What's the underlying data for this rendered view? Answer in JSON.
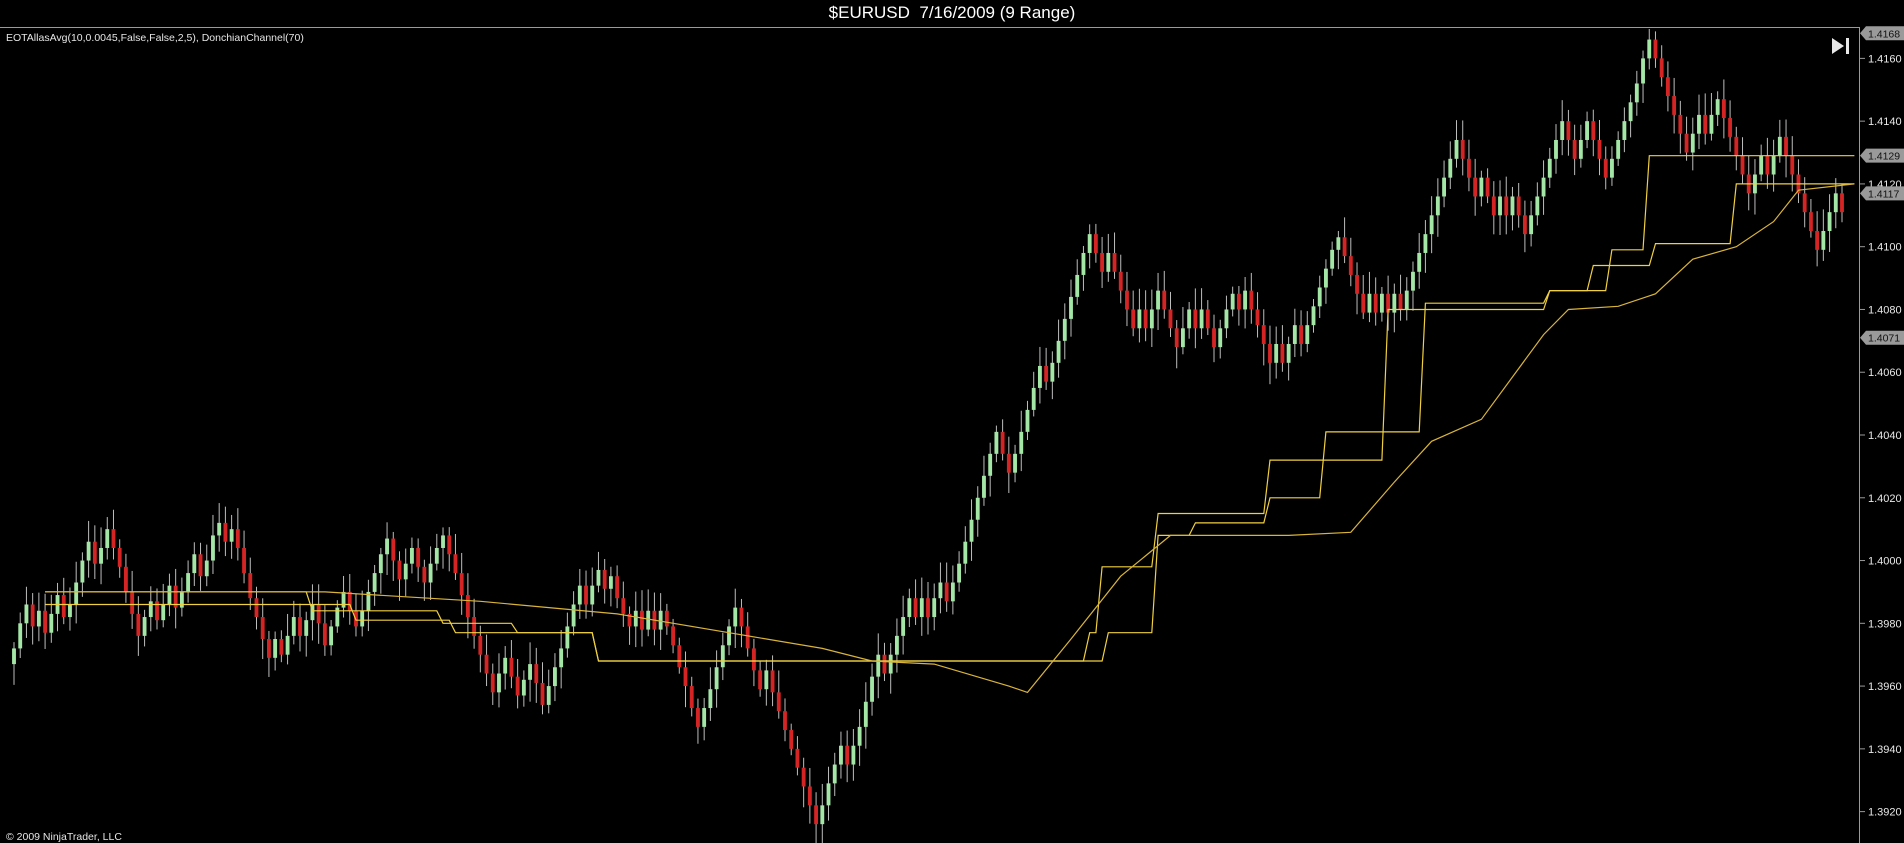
{
  "header": {
    "title": "$EURUSD  7/16/2009 (9 Range)"
  },
  "indicator_label": "EOTAllasAvg(10,0.0045,False,False,2,5), DonchianChannel(70)",
  "footer": {
    "copyright": "© 2009 NinjaTrader, LLC"
  },
  "toolbar": {
    "scroll_end_icon": "skip-to-end-icon"
  },
  "colors": {
    "background": "#000000",
    "up_candle": "#a3e6a6",
    "down_candle": "#d42424",
    "wick": "#bdbdbd",
    "indicator_line": "#d9b43a",
    "donchian_line": "#f0d040",
    "axis_text": "#e8e8e8",
    "marker_bg": "#9a9a9a"
  },
  "price_markers": [
    "1.4168",
    "1.4129",
    "1.4117",
    "1.4071"
  ],
  "chart_data": {
    "type": "candlestick",
    "instrument": "$EURUSD",
    "ylim": [
      1.391,
      1.417
    ],
    "y_ticks": [
      "1.4160",
      "1.4140",
      "1.4120",
      "1.4100",
      "1.4080",
      "1.4060",
      "1.4040",
      "1.4020",
      "1.4000",
      "1.3980",
      "1.3960",
      "1.3940",
      "1.3920"
    ],
    "grid": false,
    "legend": "none",
    "closes": [
      1.3972,
      1.398,
      1.3986,
      1.3979,
      1.3984,
      1.3977,
      1.3983,
      1.3989,
      1.3982,
      1.3986,
      1.3993,
      1.4,
      1.4006,
      1.3999,
      1.4004,
      1.401,
      1.4004,
      1.3998,
      1.399,
      1.3983,
      1.3976,
      1.3982,
      1.3987,
      1.3981,
      1.3986,
      1.3992,
      1.3985,
      1.399,
      1.3996,
      1.4002,
      1.3995,
      1.4,
      1.4008,
      1.4012,
      1.4006,
      1.401,
      1.4004,
      1.3996,
      1.3988,
      1.3982,
      1.3975,
      1.3969,
      1.3975,
      1.397,
      1.3976,
      1.3982,
      1.3976,
      1.3981,
      1.3986,
      1.398,
      1.3973,
      1.3979,
      1.3985,
      1.399,
      1.3984,
      1.3979,
      1.3984,
      1.399,
      1.3996,
      1.4002,
      1.4007,
      1.4,
      1.3994,
      1.3999,
      1.4004,
      1.3998,
      1.3993,
      1.3999,
      1.4004,
      1.4008,
      1.4002,
      1.3996,
      1.3989,
      1.3982,
      1.3976,
      1.397,
      1.3964,
      1.3958,
      1.3964,
      1.3969,
      1.3963,
      1.3957,
      1.3962,
      1.3967,
      1.3961,
      1.3954,
      1.396,
      1.3966,
      1.3972,
      1.3979,
      1.3986,
      1.3992,
      1.3986,
      1.3992,
      1.3997,
      1.3991,
      1.3995,
      1.3988,
      1.3983,
      1.3979,
      1.3984,
      1.3978,
      1.3984,
      1.3978,
      1.3984,
      1.3979,
      1.3973,
      1.3966,
      1.396,
      1.3953,
      1.3947,
      1.3953,
      1.3959,
      1.3966,
      1.3973,
      1.3979,
      1.3985,
      1.3979,
      1.3972,
      1.3965,
      1.3959,
      1.3965,
      1.3958,
      1.3952,
      1.3946,
      1.394,
      1.3934,
      1.3928,
      1.3922,
      1.3916,
      1.3922,
      1.3929,
      1.3935,
      1.3941,
      1.3935,
      1.3941,
      1.3947,
      1.3955,
      1.3963,
      1.397,
      1.3964,
      1.397,
      1.3976,
      1.3982,
      1.3988,
      1.3982,
      1.3988,
      1.3982,
      1.3988,
      1.3993,
      1.3987,
      1.3993,
      1.3999,
      1.4006,
      1.4013,
      1.402,
      1.4027,
      1.4034,
      1.4041,
      1.4034,
      1.4028,
      1.4034,
      1.4041,
      1.4048,
      1.4055,
      1.4062,
      1.4057,
      1.4063,
      1.407,
      1.4077,
      1.4084,
      1.4091,
      1.4098,
      1.4104,
      1.4098,
      1.4092,
      1.4098,
      1.4092,
      1.4086,
      1.408,
      1.4074,
      1.408,
      1.4074,
      1.408,
      1.4086,
      1.408,
      1.4074,
      1.4068,
      1.4074,
      1.408,
      1.4074,
      1.408,
      1.4074,
      1.4068,
      1.4074,
      1.408,
      1.4085,
      1.408,
      1.4086,
      1.408,
      1.4075,
      1.4069,
      1.4063,
      1.4069,
      1.4063,
      1.4069,
      1.4075,
      1.4069,
      1.4075,
      1.4081,
      1.4087,
      1.4093,
      1.4099,
      1.4103,
      1.4097,
      1.4091,
      1.4085,
      1.4079,
      1.4085,
      1.4079,
      1.4085,
      1.4079,
      1.4085,
      1.408,
      1.4086,
      1.4092,
      1.4098,
      1.4104,
      1.411,
      1.4116,
      1.4122,
      1.4128,
      1.4134,
      1.4128,
      1.4122,
      1.4116,
      1.4122,
      1.4116,
      1.411,
      1.4116,
      1.411,
      1.4116,
      1.411,
      1.4104,
      1.411,
      1.4116,
      1.4122,
      1.4128,
      1.4134,
      1.414,
      1.4134,
      1.4128,
      1.4134,
      1.414,
      1.4134,
      1.4128,
      1.4122,
      1.4128,
      1.4134,
      1.414,
      1.4146,
      1.4152,
      1.416,
      1.4166,
      1.416,
      1.4154,
      1.4148,
      1.4142,
      1.4136,
      1.413,
      1.4136,
      1.4142,
      1.4136,
      1.4142,
      1.4147,
      1.4141,
      1.4135,
      1.4129,
      1.4123,
      1.4117,
      1.4123,
      1.4129,
      1.4123,
      1.4129,
      1.4135,
      1.4129,
      1.4123,
      1.4117,
      1.4111,
      1.4105,
      1.4099,
      1.4105,
      1.4111,
      1.4117,
      1.4111
    ],
    "indicator_line": [
      [
        5,
        1.399
      ],
      [
        50,
        1.399
      ],
      [
        75,
        1.3987
      ],
      [
        97,
        1.3983
      ],
      [
        115,
        1.3977
      ],
      [
        130,
        1.3972
      ],
      [
        138,
        1.3968
      ],
      [
        148,
        1.3967
      ],
      [
        160,
        1.396
      ],
      [
        163,
        1.3958
      ],
      [
        170,
        1.3975
      ],
      [
        178,
        1.3995
      ],
      [
        186,
        1.4008
      ],
      [
        205,
        1.4008
      ],
      [
        215,
        1.4009
      ],
      [
        222,
        1.4025
      ],
      [
        228,
        1.4038
      ],
      [
        236,
        1.4045
      ],
      [
        246,
        1.4072
      ],
      [
        250,
        1.408
      ],
      [
        258,
        1.4081
      ],
      [
        264,
        1.4085
      ],
      [
        270,
        1.4096
      ],
      [
        277,
        1.41
      ],
      [
        283,
        1.4108
      ],
      [
        287,
        1.4118
      ],
      [
        296,
        1.412
      ]
    ],
    "donchian_upper": [
      [
        5,
        1.399
      ],
      [
        47,
        1.399
      ],
      [
        48,
        1.3984
      ],
      [
        68,
        1.3984
      ],
      [
        69,
        1.398
      ],
      [
        80,
        1.398
      ],
      [
        81,
        1.3977
      ],
      [
        93,
        1.3977
      ],
      [
        94,
        1.3968
      ],
      [
        175,
        1.3968
      ],
      [
        176,
        1.3977
      ],
      [
        183,
        1.3977
      ],
      [
        184,
        1.4008
      ],
      [
        189,
        1.4008
      ],
      [
        190,
        1.4012
      ],
      [
        201,
        1.4012
      ],
      [
        202,
        1.402
      ],
      [
        210,
        1.402
      ],
      [
        211,
        1.4041
      ],
      [
        226,
        1.4041
      ],
      [
        227,
        1.4082
      ],
      [
        246,
        1.4082
      ],
      [
        247,
        1.4086
      ],
      [
        253,
        1.4086
      ],
      [
        254,
        1.4094
      ],
      [
        263,
        1.4094
      ],
      [
        264,
        1.4101
      ],
      [
        276,
        1.4101
      ],
      [
        277,
        1.412
      ],
      [
        296,
        1.412
      ]
    ],
    "donchian_lower": [
      [
        5,
        1.3986
      ],
      [
        54,
        1.3986
      ],
      [
        55,
        1.3981
      ],
      [
        70,
        1.3981
      ],
      [
        71,
        1.3977
      ],
      [
        93,
        1.3977
      ],
      [
        94,
        1.3968
      ],
      [
        127,
        1.3968
      ],
      [
        128,
        1.3968
      ],
      [
        172,
        1.3968
      ],
      [
        173,
        1.3977
      ],
      [
        174,
        1.3977
      ],
      [
        175,
        1.3998
      ],
      [
        183,
        1.3998
      ],
      [
        184,
        1.4015
      ],
      [
        201,
        1.4015
      ],
      [
        202,
        1.4032
      ],
      [
        220,
        1.4032
      ],
      [
        221,
        1.408
      ],
      [
        246,
        1.408
      ],
      [
        247,
        1.4086
      ],
      [
        256,
        1.4086
      ],
      [
        257,
        1.4099
      ],
      [
        262,
        1.4099
      ],
      [
        263,
        1.4129
      ],
      [
        296,
        1.4129
      ]
    ]
  }
}
